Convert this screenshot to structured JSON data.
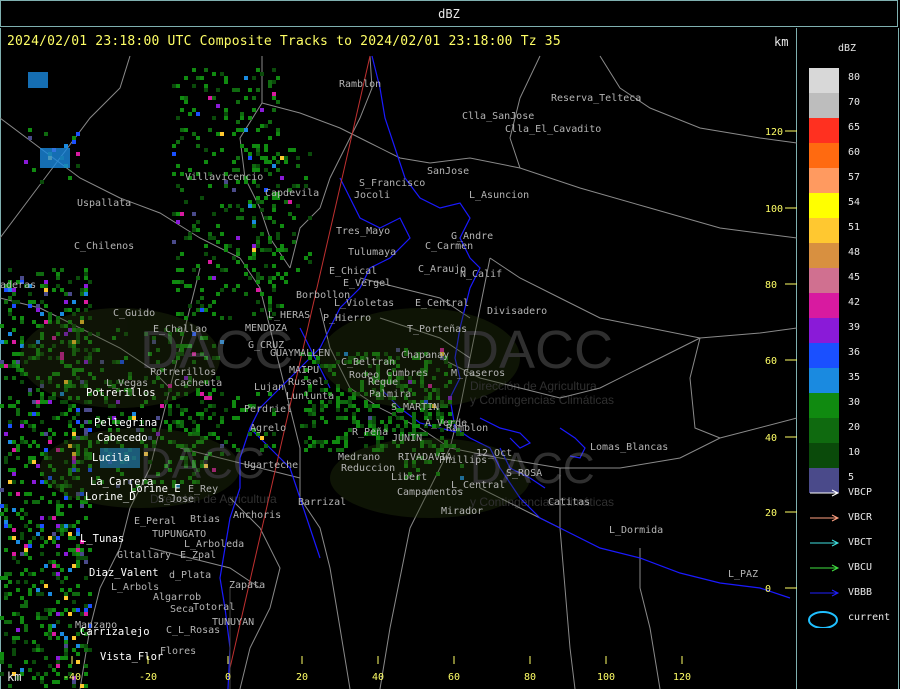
{
  "window": {
    "title": "dBZ"
  },
  "header": {
    "text": "2024/02/01 23:18:00 UTC Composite Tracks to 2024/02/01 23:18:00 Tz 35",
    "km_right": "km",
    "km_bottom": "km"
  },
  "colors": {
    "frame": "#7fb0b0",
    "header_text": "#ffff66",
    "boundary": "#8a8a8a",
    "river": "#1a1aff",
    "track_line": "#c03030",
    "axis": "#ffff66"
  },
  "y_axis_ticks": [
    "120",
    "100",
    "80",
    "60",
    "40",
    "20",
    "0"
  ],
  "x_axis_ticks": [
    "-40",
    "-20",
    "0",
    "20",
    "40",
    "60",
    "80",
    "100",
    "120"
  ],
  "legend": {
    "title": "dBZ",
    "entries": [
      {
        "label": "80",
        "color": "#d8d8d8"
      },
      {
        "label": "70",
        "color": "#bdbdbd"
      },
      {
        "label": "65",
        "color": "#ff3020"
      },
      {
        "label": "60",
        "color": "#ff6a10"
      },
      {
        "label": "57",
        "color": "#ff9a60"
      },
      {
        "label": "54",
        "color": "#ffff00"
      },
      {
        "label": "51",
        "color": "#ffc830"
      },
      {
        "label": "48",
        "color": "#d89040"
      },
      {
        "label": "45",
        "color": "#d07090"
      },
      {
        "label": "42",
        "color": "#d81aa0"
      },
      {
        "label": "39",
        "color": "#8a1ad8"
      },
      {
        "label": "36",
        "color": "#1a50ff"
      },
      {
        "label": "35",
        "color": "#1a8ae0"
      },
      {
        "label": "30",
        "color": "#108a10"
      },
      {
        "label": "20",
        "color": "#0f6a0f"
      },
      {
        "label": "10",
        "color": "#0a4a0a"
      },
      {
        "label": "5",
        "color": "#4a4a8a"
      }
    ]
  },
  "tracks": [
    {
      "label": "VBCP",
      "color": "#ffffff"
    },
    {
      "label": "VBCR",
      "color": "#ffa080"
    },
    {
      "label": "VBCT",
      "color": "#40e0e0"
    },
    {
      "label": "VBCU",
      "color": "#40e040"
    },
    {
      "label": "VBBB",
      "color": "#2020ff"
    },
    {
      "label": "current",
      "color": "#20c0ff"
    }
  ],
  "places_gray": [
    {
      "name": "Ramblon"
    },
    {
      "name": "Reserva_Telteca"
    },
    {
      "name": "Clla_SanJose"
    },
    {
      "name": "Clla_El_Cavadito"
    },
    {
      "name": "SanJose"
    },
    {
      "name": "S_Francisco"
    },
    {
      "name": "Jocoli"
    },
    {
      "name": "L_Asuncion"
    },
    {
      "name": "Villavicencio"
    },
    {
      "name": "Capdevila"
    },
    {
      "name": "Uspallata"
    },
    {
      "name": "Tres_Mayo"
    },
    {
      "name": "G_Andre"
    },
    {
      "name": "C_Carmen"
    },
    {
      "name": "C_Chilenos"
    },
    {
      "name": "Tulumaya"
    },
    {
      "name": "E_Chical"
    },
    {
      "name": "C_Araujo"
    },
    {
      "name": "N_Calif"
    },
    {
      "name": "E_Vergel"
    },
    {
      "name": "Borbollon"
    },
    {
      "name": "L_Violetas"
    },
    {
      "name": "E_Central"
    },
    {
      "name": "Divisadero"
    },
    {
      "name": "C_Guido"
    },
    {
      "name": "L_HERAS"
    },
    {
      "name": "P_Hierro"
    },
    {
      "name": "T_Porteñas"
    },
    {
      "name": "E_Challao"
    },
    {
      "name": "MENDOZA"
    },
    {
      "name": "G_CRUZ"
    },
    {
      "name": "GUAYMALLEN"
    },
    {
      "name": "C_Beltran"
    },
    {
      "name": "Chapanay"
    },
    {
      "name": "MAIPU"
    },
    {
      "name": "Rodeo"
    },
    {
      "name": "Cumbres"
    },
    {
      "name": "Russel"
    },
    {
      "name": "Reque"
    },
    {
      "name": "M_Caseros"
    },
    {
      "name": "Potrerillos"
    },
    {
      "name": "L_Vegas"
    },
    {
      "name": "Cacheuta"
    },
    {
      "name": "Lujan"
    },
    {
      "name": "Lunlunta"
    },
    {
      "name": "Palmira"
    },
    {
      "name": "Perdriel"
    },
    {
      "name": "S_MARTIN"
    },
    {
      "name": "A_Verde"
    },
    {
      "name": "Agrelo"
    },
    {
      "name": "R_Peña"
    },
    {
      "name": "JUNIN"
    },
    {
      "name": "Ramblon"
    },
    {
      "name": "Lomas_Blancas"
    },
    {
      "name": "Medrano"
    },
    {
      "name": "RIVADAVIA"
    },
    {
      "name": "Phillips"
    },
    {
      "name": "12_Oct"
    },
    {
      "name": "Ugarteche"
    },
    {
      "name": "Reduccion"
    },
    {
      "name": "S_ROSA"
    },
    {
      "name": "Libert"
    },
    {
      "name": "L_Central"
    },
    {
      "name": "Campamentos"
    },
    {
      "name": "Barrizal"
    },
    {
      "name": "Catitas"
    },
    {
      "name": "Mirador"
    },
    {
      "name": "Anchoris"
    },
    {
      "name": "L_Dormida"
    },
    {
      "name": "E_Peral"
    },
    {
      "name": "Btias"
    },
    {
      "name": "TUPUNGATO"
    },
    {
      "name": "L_Arboleda"
    },
    {
      "name": "Gltallary"
    },
    {
      "name": "E_Zpal"
    },
    {
      "name": "d_Plata"
    },
    {
      "name": "Zapata"
    },
    {
      "name": "L_Arbols"
    },
    {
      "name": "Algarrob"
    },
    {
      "name": "Seca"
    },
    {
      "name": "Totoral"
    },
    {
      "name": "TUNUYAN"
    },
    {
      "name": "C_L_Rosas"
    },
    {
      "name": "Manzano"
    },
    {
      "name": "Flores"
    },
    {
      "name": "L_PAZ"
    },
    {
      "name": "E_Rey"
    },
    {
      "name": "S_Jose"
    },
    {
      "name": "aderas"
    }
  ],
  "places_white": [
    {
      "name": "Potrerillos"
    },
    {
      "name": "Pellegrina"
    },
    {
      "name": "Cabecedo"
    },
    {
      "name": "Lucila"
    },
    {
      "name": "La_Carrera"
    },
    {
      "name": "Lorine_D"
    },
    {
      "name": "Lorine_E"
    },
    {
      "name": "L_Tunas"
    },
    {
      "name": "Diaz_Valent"
    },
    {
      "name": "Carrizalejo"
    },
    {
      "name": "Vista_Flor"
    }
  ],
  "watermark": {
    "brand": "DACC",
    "line1": "Dirección de Agricultura",
    "line2": "y Contingencias Climáticas"
  }
}
